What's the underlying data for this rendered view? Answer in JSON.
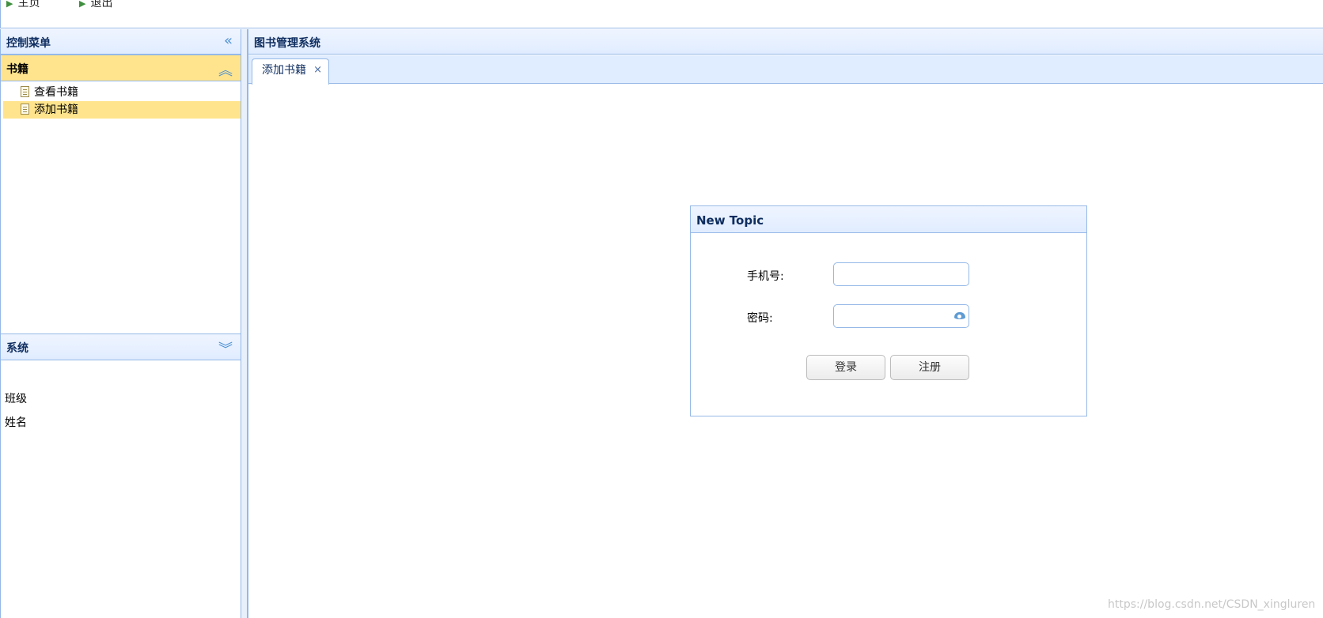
{
  "topbar": {
    "nav": [
      {
        "label": "主页"
      },
      {
        "label": "退出"
      }
    ]
  },
  "west": {
    "title": "控制菜单",
    "groups": [
      {
        "title": "书籍",
        "items": [
          {
            "label": "查看书籍",
            "icon": "document-icon",
            "active": false
          },
          {
            "label": "添加书籍",
            "icon": "document-icon",
            "active": true
          }
        ]
      },
      {
        "title": "系统",
        "items": [
          {
            "label": "班级"
          },
          {
            "label": "姓名"
          }
        ]
      }
    ]
  },
  "center": {
    "title": "图书管理系统",
    "tabs": [
      {
        "label": "添加书籍",
        "close": "×"
      }
    ]
  },
  "dialog": {
    "title": "New Topic",
    "phone_label": "手机号:",
    "phone_value": "",
    "password_label": "密码:",
    "password_value": "",
    "login_label": "登录",
    "register_label": "注册"
  },
  "watermark": "https://blog.csdn.net/CSDN_xingluren",
  "colors": {
    "border": "#95b8e7",
    "header_bg": "#e0ecff",
    "selected_bg": "#ffe48d",
    "title_text": "#0e2d5f",
    "icon_blue": "#4a8fd6"
  }
}
